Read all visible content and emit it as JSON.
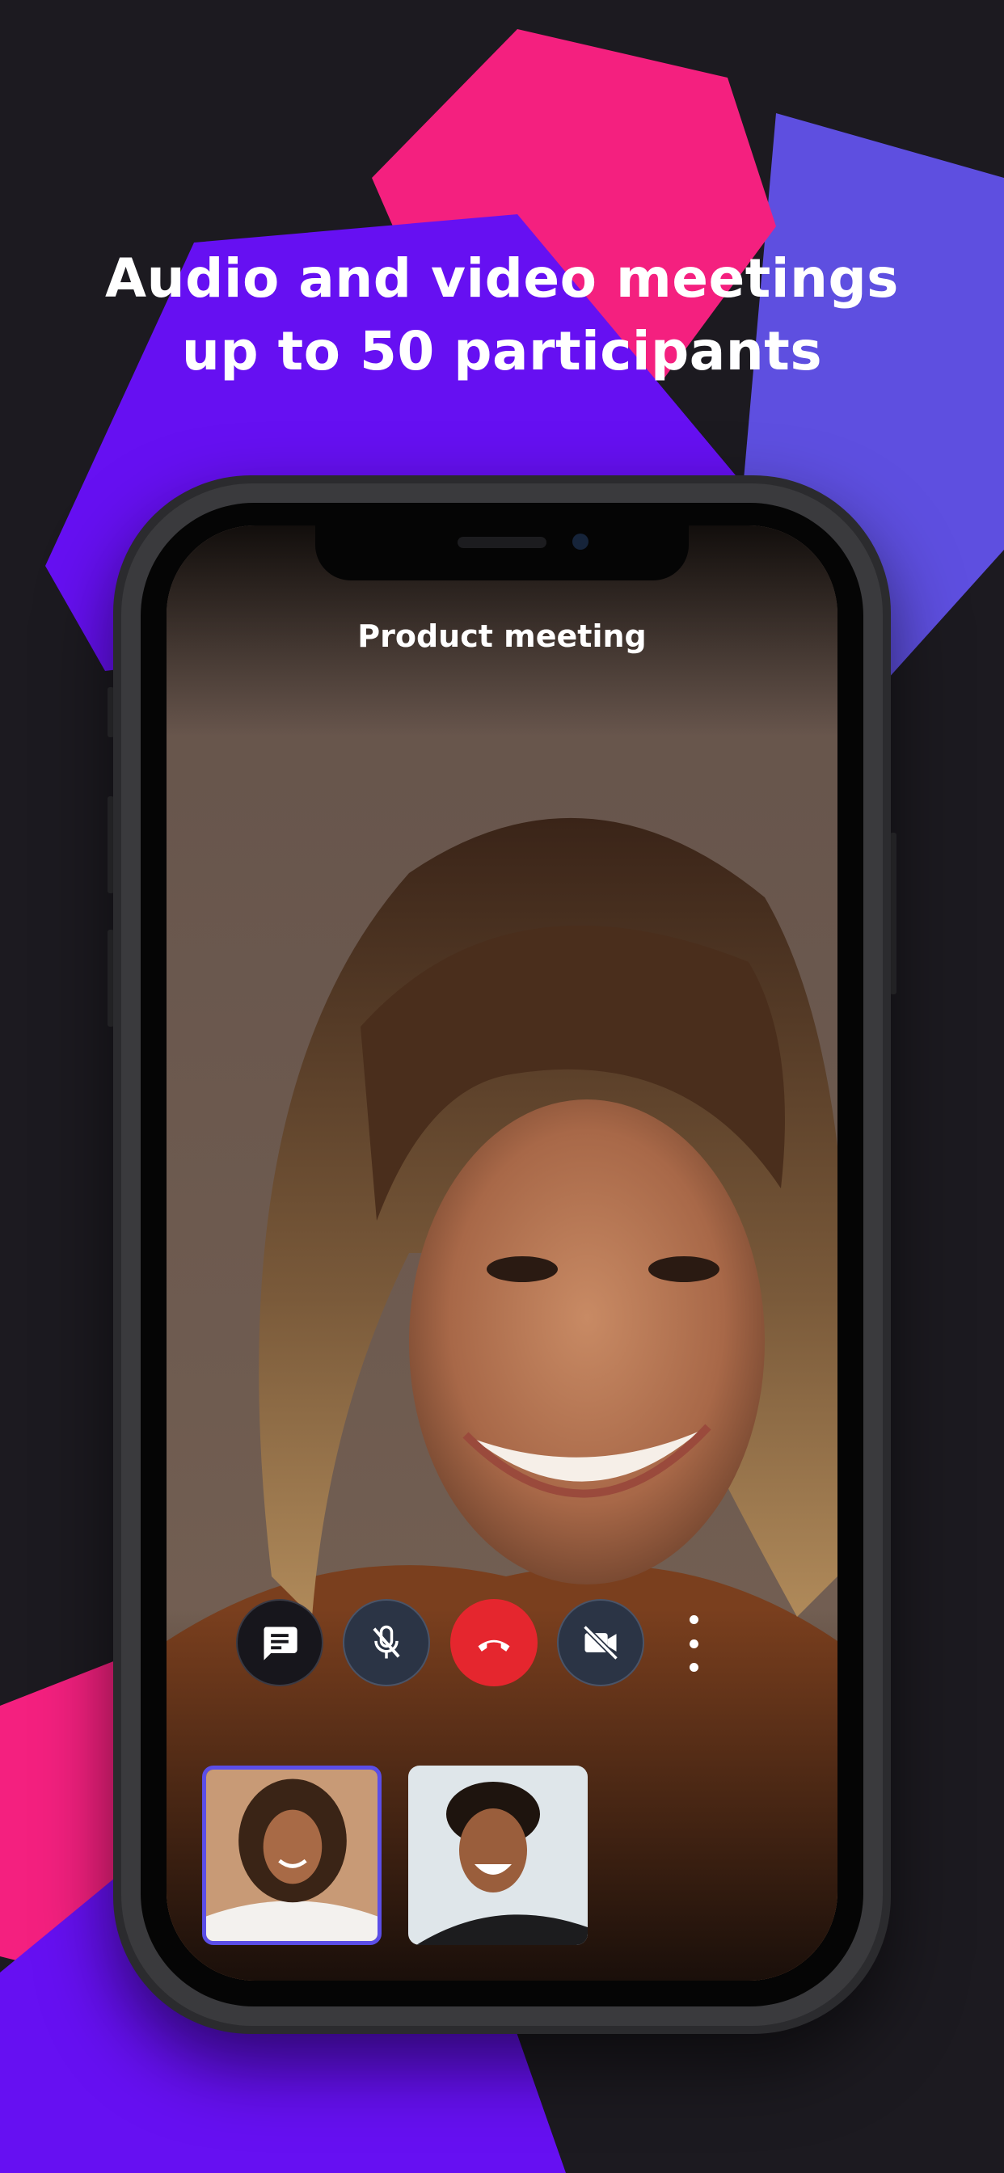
{
  "headline": {
    "line1": "Audio and video meetings",
    "line2": "up to 50 participants"
  },
  "colors": {
    "background": "#1c1a20",
    "pink": "#f4207f",
    "violet": "#6610f2",
    "lavender": "#5e4fe0",
    "end_call_red": "#e5262e",
    "active_tile_border": "#5b4ee8"
  },
  "call": {
    "title": "Product meeting",
    "controls": [
      {
        "name": "chat-button",
        "icon": "chat-icon"
      },
      {
        "name": "mute-microphone-button",
        "icon": "microphone-off-icon"
      },
      {
        "name": "end-call-button",
        "icon": "phone-hangup-icon"
      },
      {
        "name": "camera-off-button",
        "icon": "video-off-icon"
      },
      {
        "name": "more-options-button",
        "icon": "more-vertical-icon"
      }
    ],
    "participants": [
      {
        "name": "participant-tile-1",
        "active": true
      },
      {
        "name": "participant-tile-2",
        "active": false
      }
    ]
  }
}
